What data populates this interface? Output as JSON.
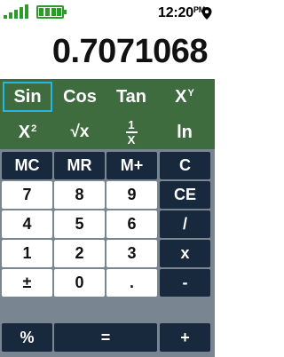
{
  "status_bar": {
    "time": "12:20",
    "am_pm": "PM",
    "signal_icon": "signal-bars-icon",
    "battery_icon": "battery-icon",
    "gps_icon": "gps-pin-icon",
    "accent_color": "#2e9a2c"
  },
  "display": {
    "value": "0.7071068"
  },
  "functions": {
    "row1": [
      {
        "label": "Sin",
        "selected": true
      },
      {
        "label": "Cos"
      },
      {
        "label": "Tan"
      },
      {
        "label": "X",
        "sup": "Y"
      }
    ],
    "row2": [
      {
        "label": "X",
        "sup": "2"
      },
      {
        "label": "√x"
      },
      {
        "num": "1",
        "den": "X"
      },
      {
        "label": "ln"
      }
    ]
  },
  "keypad": {
    "memory": [
      "MC",
      "MR",
      "M+",
      "C"
    ],
    "rows": [
      [
        "7",
        "8",
        "9",
        "CE"
      ],
      [
        "4",
        "5",
        "6",
        "/"
      ],
      [
        "1",
        "2",
        "3",
        "x"
      ],
      [
        "±",
        "0",
        ".",
        "-"
      ]
    ],
    "bottom": {
      "percent": "%",
      "equals": "=",
      "plus": "+"
    }
  },
  "colors": {
    "function_bg": "#3f6c3e",
    "selection_border": "#27b4e6",
    "dark_key": "#18283d",
    "grid": "#7a8592"
  }
}
